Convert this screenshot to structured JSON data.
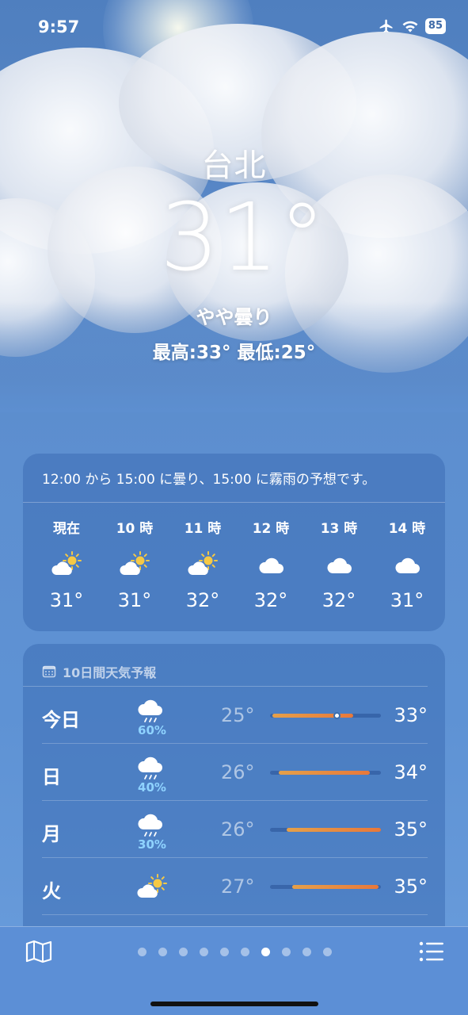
{
  "status_bar": {
    "time": "9:57",
    "battery": "85"
  },
  "hero": {
    "city": "台北",
    "temperature": "31°",
    "condition": "やや曇り",
    "high_low": "最高:33° 最低:25°"
  },
  "hourly": {
    "summary": "12:00 から 15:00 に曇り、15:00 に霧雨の予想です。",
    "hours": [
      {
        "label": "現在",
        "icon": "partly-sunny-icon",
        "temp": "31°"
      },
      {
        "label": "10 時",
        "icon": "partly-sunny-icon",
        "temp": "31°"
      },
      {
        "label": "11 時",
        "icon": "partly-sunny-icon",
        "temp": "32°"
      },
      {
        "label": "12 時",
        "icon": "cloud-icon",
        "temp": "32°"
      },
      {
        "label": "13 時",
        "icon": "cloud-icon",
        "temp": "32°"
      },
      {
        "label": "14 時",
        "icon": "cloud-icon",
        "temp": "31°"
      }
    ]
  },
  "daily": {
    "header": "10日間天気予報",
    "days": [
      {
        "day": "今日",
        "icon": "rain-cloud-icon",
        "precip": "60%",
        "low": "25°",
        "high": "33°",
        "bar_start": 0.02,
        "bar_end": 0.75,
        "current": 0.6
      },
      {
        "day": "日",
        "icon": "rain-cloud-icon",
        "precip": "40%",
        "low": "26°",
        "high": "34°",
        "bar_start": 0.08,
        "bar_end": 0.9
      },
      {
        "day": "月",
        "icon": "rain-cloud-icon",
        "precip": "30%",
        "low": "26°",
        "high": "35°",
        "bar_start": 0.15,
        "bar_end": 1.0
      },
      {
        "day": "火",
        "icon": "partly-sunny-icon",
        "precip": "",
        "low": "27°",
        "high": "35°",
        "bar_start": 0.2,
        "bar_end": 0.98
      }
    ]
  },
  "pager": {
    "count": 10,
    "active_index": 6
  },
  "colors": {
    "accent_bar_start": "#e5a04a",
    "accent_bar_end": "#e8783a",
    "precip": "#8fd3ff"
  }
}
